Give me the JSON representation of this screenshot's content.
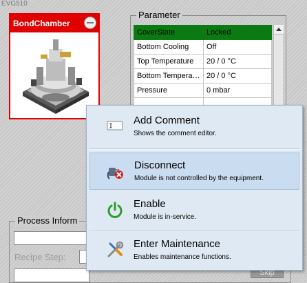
{
  "app": {
    "title": "EVG510"
  },
  "module": {
    "name": "BondChamber",
    "state_color": "#e00000"
  },
  "parameter_panel": {
    "title": "Parameter",
    "rows": [
      {
        "name": "CoverState",
        "value": "Locked"
      },
      {
        "name": "Bottom Cooling",
        "value": "Off"
      },
      {
        "name": "Top Temperature",
        "value": "20 / 0 °C"
      },
      {
        "name": "Bottom Temperat...",
        "value": "20 / 0 °C"
      },
      {
        "name": "Pressure",
        "value": "0 mbar"
      }
    ],
    "highlight_color": "#0b7a12"
  },
  "process_panel": {
    "title": "Process Inform",
    "recipe_step_label": "Recipe Step:",
    "skip_label": "Skip"
  },
  "context_menu": {
    "items": [
      {
        "title": "Add Comment",
        "description": "Shows the comment editor.",
        "icon": "comment-icon"
      },
      {
        "title": "Disconnect",
        "description": "Module is not controlled by the equipment.",
        "icon": "unplug-icon"
      },
      {
        "title": "Enable",
        "description": "Module is in-service.",
        "icon": "power-icon"
      },
      {
        "title": "Enter Maintenance",
        "description": "Enables maintenance functions.",
        "icon": "tools-icon"
      }
    ]
  }
}
